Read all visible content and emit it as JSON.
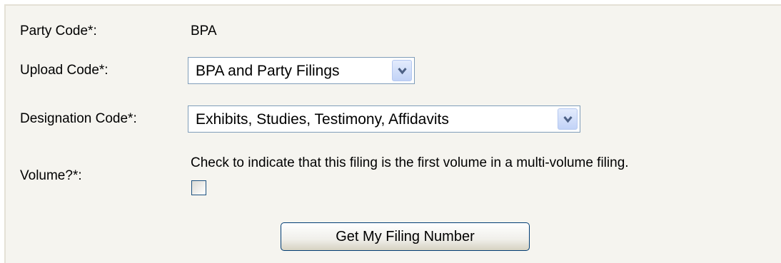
{
  "form": {
    "party_code": {
      "label": "Party Code*:",
      "value": "BPA"
    },
    "upload_code": {
      "label": "Upload Code*:",
      "selected": "BPA and Party Filings",
      "icon": "chevron-down-icon"
    },
    "designation_code": {
      "label": "Designation Code*:",
      "selected": "Exhibits, Studies, Testimony, Affidavits",
      "icon": "chevron-down-icon"
    },
    "volume": {
      "label": "Volume?*:",
      "help_text": "Check to indicate that this filing is the first volume in a multi-volume filing.",
      "checked": false
    },
    "submit_label": "Get My Filing Number"
  },
  "colors": {
    "panel_background": "#f5f4ef",
    "field_border": "#7f9db9",
    "button_border": "#003c74",
    "arrow_button": "#c2d3f7"
  }
}
